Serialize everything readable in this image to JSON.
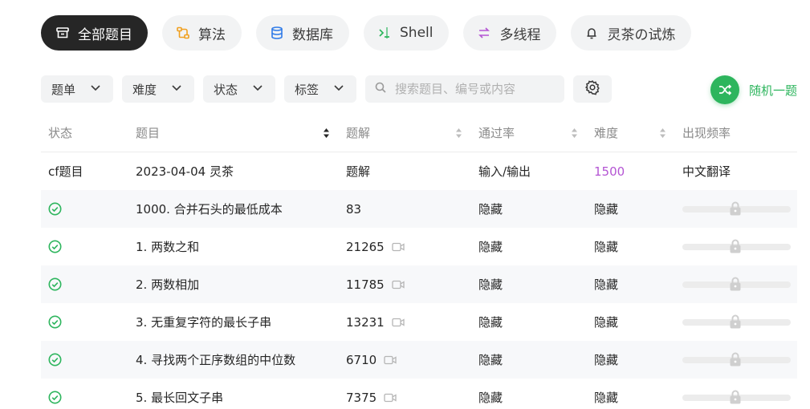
{
  "categories": [
    {
      "label": "全部题目",
      "icon": "inbox-icon",
      "active": true
    },
    {
      "label": "算法",
      "icon": "flow-icon"
    },
    {
      "label": "数据库",
      "icon": "database-icon"
    },
    {
      "label": "Shell",
      "icon": "terminal-icon"
    },
    {
      "label": "多线程",
      "icon": "threads-icon"
    },
    {
      "label": "灵茶の试炼",
      "icon": "bell-icon"
    }
  ],
  "filters": {
    "list": "题单",
    "difficulty": "难度",
    "status": "状态",
    "tags": "标签",
    "search_placeholder": "搜索题目、编号或内容"
  },
  "random_pick": "随机一题",
  "colors": {
    "accent_green": "#2db55d",
    "difficulty_purple": "#b455d3",
    "active_pill": "#262626"
  },
  "table": {
    "headers": {
      "status": "状态",
      "title": "题目",
      "solutions": "题解",
      "pass_rate": "通过率",
      "difficulty": "难度",
      "frequency": "出现频率"
    },
    "pinned": {
      "status": "cf题目",
      "title": "2023-04-04 灵茶",
      "solutions": "题解",
      "pass_rate": "输入/输出",
      "difficulty": "1500",
      "frequency": "中文翻译"
    },
    "rows": [
      {
        "title": "1000. 合并石头的最低成本",
        "solutions": "83",
        "video": false,
        "pass_rate": "隐藏",
        "difficulty": "隐藏"
      },
      {
        "title": "1. 两数之和",
        "solutions": "21265",
        "video": true,
        "pass_rate": "隐藏",
        "difficulty": "隐藏"
      },
      {
        "title": "2. 两数相加",
        "solutions": "11785",
        "video": true,
        "pass_rate": "隐藏",
        "difficulty": "隐藏"
      },
      {
        "title": "3. 无重复字符的最长子串",
        "solutions": "13231",
        "video": true,
        "pass_rate": "隐藏",
        "difficulty": "隐藏"
      },
      {
        "title": "4. 寻找两个正序数组的中位数",
        "solutions": "6710",
        "video": true,
        "pass_rate": "隐藏",
        "difficulty": "隐藏"
      },
      {
        "title": "5. 最长回文子串",
        "solutions": "7375",
        "video": true,
        "pass_rate": "隐藏",
        "difficulty": "隐藏"
      }
    ]
  }
}
